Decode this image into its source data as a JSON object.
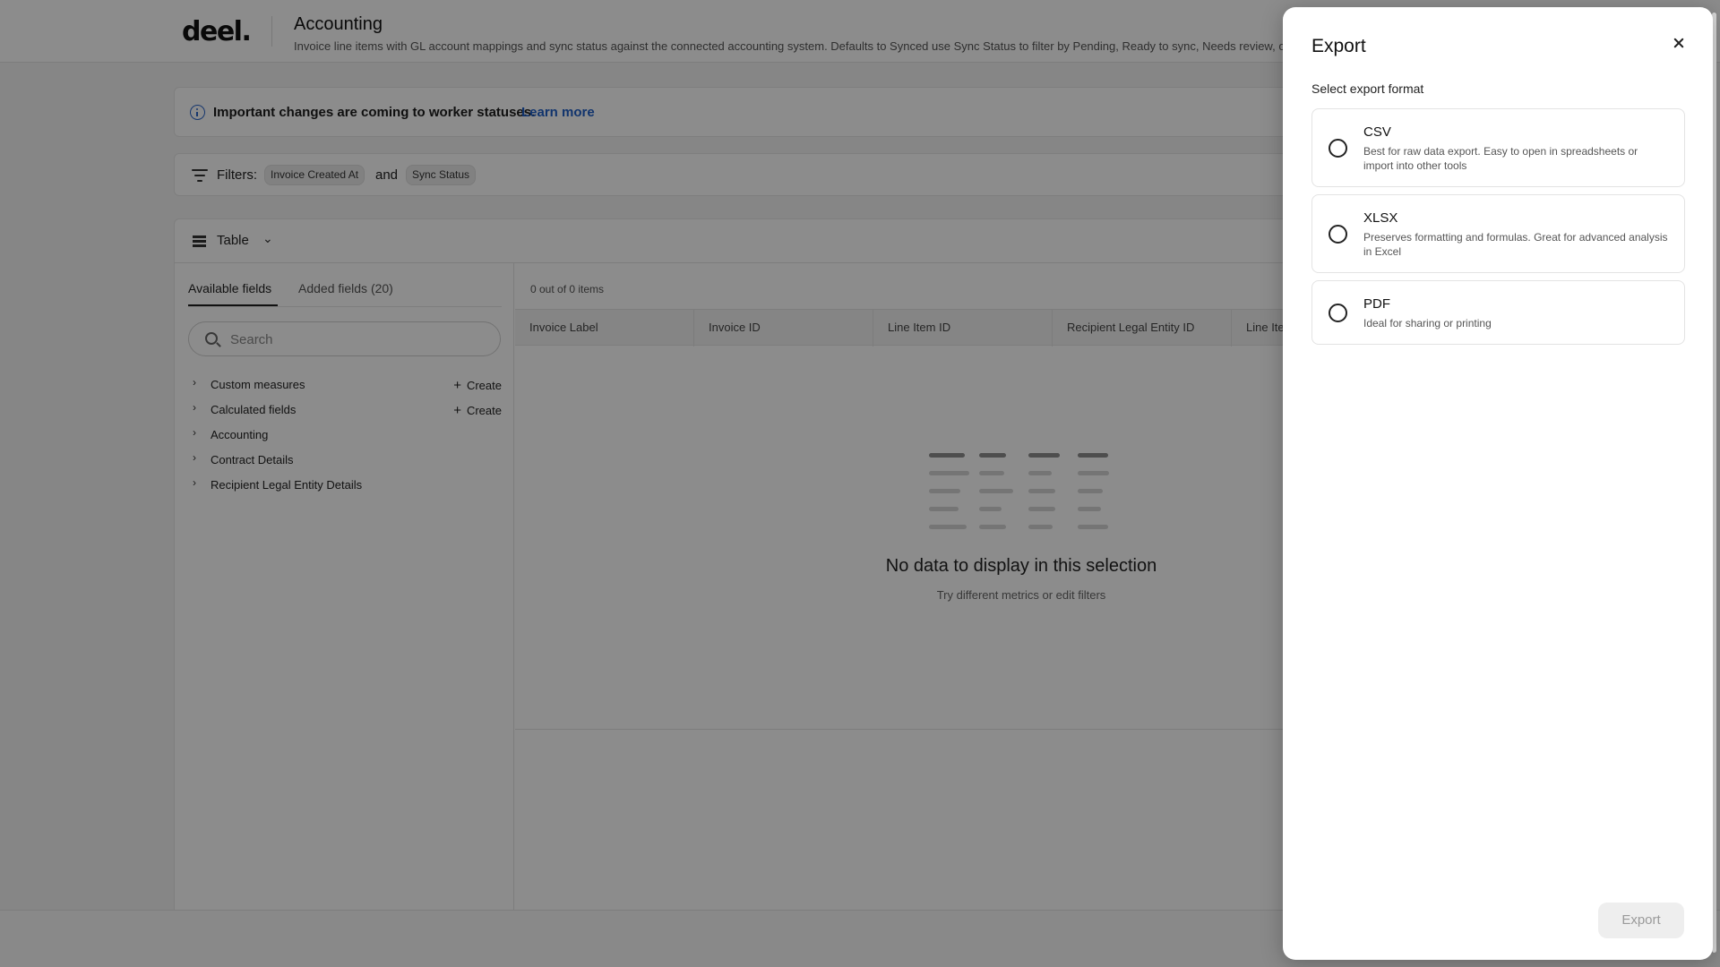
{
  "header": {
    "logo": "deel.",
    "title": "Accounting",
    "subtitle": "Invoice line items with GL account mappings and sync status against the connected accounting system. Defaults to Synced use Sync Status to filter by Pending, Ready to sync, Needs review, or D"
  },
  "banner": {
    "text": "Important changes are coming to worker statuses.",
    "link": "Learn more",
    "icon": "info-icon"
  },
  "filters": {
    "label": "Filters:",
    "chips": [
      "Invoice Created At",
      "Sync Status"
    ],
    "joiner": "and"
  },
  "view": {
    "label": "Table"
  },
  "left_panel": {
    "tabs": [
      "Available fields",
      "Added fields (20)"
    ],
    "search_placeholder": "Search",
    "tree": [
      {
        "label": "Custom measures",
        "action": "Create"
      },
      {
        "label": "Calculated fields",
        "action": "Create"
      },
      {
        "label": "Accounting",
        "action": ""
      },
      {
        "label": "Contract Details",
        "action": ""
      },
      {
        "label": "Recipient Legal Entity Details",
        "action": ""
      }
    ]
  },
  "results": {
    "count": "0 out of 0 items",
    "columns": [
      "Invoice Label",
      "Invoice ID",
      "Line Item ID",
      "Recipient Legal Entity ID",
      "Line Ite"
    ],
    "empty_title": "No data to display in this selection",
    "empty_subtitle": "Try different metrics or edit filters"
  },
  "export_drawer": {
    "title": "Export",
    "label": "Select export format",
    "options": [
      {
        "title": "CSV",
        "description": "Best for raw data export. Easy to open in spreadsheets or import into other tools"
      },
      {
        "title": "XLSX",
        "description": "Preserves formatting and formulas. Great for advanced analysis in Excel"
      },
      {
        "title": "PDF",
        "description": "Ideal for sharing or printing"
      }
    ],
    "export_button": "Export"
  },
  "colors": {
    "link": "#2060c6",
    "overlay": "rgba(0,0,0,0.45)",
    "disabled_button": "#eeeeee"
  }
}
